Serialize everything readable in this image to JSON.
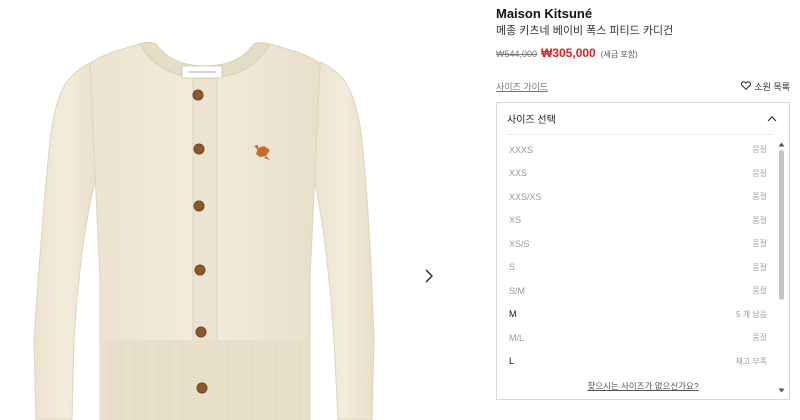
{
  "product": {
    "brand": "Maison Kitsuné",
    "name": "메종 키츠네 베이비 폭스 피티드 카디건",
    "original_price": "₩544,000",
    "sale_price": "₩305,000",
    "tax_note": "(세금 포함)"
  },
  "links": {
    "size_guide": "사이즈 가이드",
    "wishlist": "소원 목록"
  },
  "size_select": {
    "title": "사이즈 선택",
    "expanded": true,
    "options": [
      {
        "size": "XXXS",
        "status": "품절",
        "available": false
      },
      {
        "size": "XXS",
        "status": "품절",
        "available": false
      },
      {
        "size": "XXS/XS",
        "status": "품절",
        "available": false
      },
      {
        "size": "XS",
        "status": "품절",
        "available": false
      },
      {
        "size": "XS/S",
        "status": "품절",
        "available": false
      },
      {
        "size": "S",
        "status": "품절",
        "available": false
      },
      {
        "size": "S/M",
        "status": "품절",
        "available": false
      },
      {
        "size": "M",
        "status": "5 개 남음",
        "available": true
      },
      {
        "size": "M/L",
        "status": "품절",
        "available": false
      },
      {
        "size": "L",
        "status": "재고 부족",
        "available": true
      }
    ],
    "not_found_link": "찾으시는 사이즈가 없으신가요?"
  },
  "colors": {
    "sale": "#e02020",
    "garment": "#f1ead8",
    "button": "#8a5a2e"
  },
  "icons": {
    "carousel": "chevron-right-icon",
    "wishlist": "heart-icon",
    "dropdown": "chevron-up-icon"
  }
}
